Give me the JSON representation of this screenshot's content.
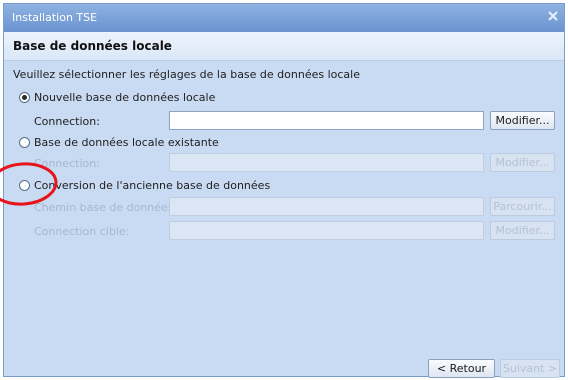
{
  "window": {
    "title": "Installation TSE"
  },
  "header": {
    "title": "Base de données locale"
  },
  "description": "Veuillez sélectionner les réglages de la base de données locale",
  "options": {
    "new_db": {
      "label": "Nouvelle base de données locale",
      "checked": true
    },
    "existing_db": {
      "label": "Base de données locale existante",
      "checked": false
    },
    "convert_db": {
      "label": "Conversion de l'ancienne base de données",
      "checked": false
    }
  },
  "fields": {
    "new_connection": {
      "label": "Connection:",
      "value": "",
      "button": "Modifier..."
    },
    "existing_connection": {
      "label": "Connection:",
      "value": "",
      "button": "Modifier..."
    },
    "old_db_path": {
      "label": "Chemin base de données:",
      "value": "",
      "button": "Parcourir..."
    },
    "target_connection": {
      "label": "Connection cible:",
      "value": "",
      "button": "Modifier..."
    }
  },
  "footer": {
    "back": "< Retour",
    "next": "Suivant >"
  },
  "colors": {
    "highlight_circle": "#e8141c"
  }
}
